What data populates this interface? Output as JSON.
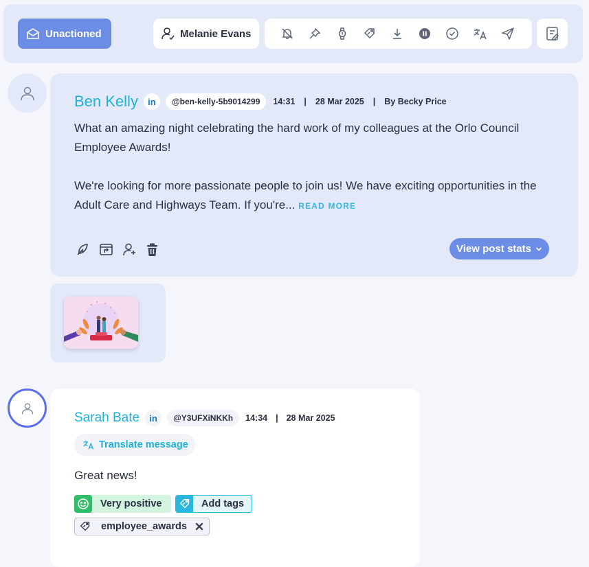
{
  "toolbar": {
    "status_label": "Unactioned",
    "assignee_name": "Melanie Evans",
    "tool_icons": [
      "bell-off-icon",
      "pin-icon",
      "watch-icon",
      "tag-icon",
      "download-icon",
      "pause-icon",
      "check-circle-icon",
      "translate-icon",
      "send-icon"
    ],
    "notes_icon": "notes-icon"
  },
  "post": {
    "author": "Ben Kelly",
    "network_badge": "in",
    "handle": "@ben-kelly-5b9014299",
    "time": "14:31",
    "separator": "|",
    "date": "28 Mar 2025",
    "by": "By Becky Price",
    "body_line1": "What an amazing night celebrating the hard work of my colleagues at the Orlo Council",
    "body_line2": "Employee Awards!",
    "body_line3": "We're looking for more passionate people to join us! We have exciting opportunities in the",
    "body_line4": "Adult Care and Highways Team. If you're...",
    "read_more": "READ MORE",
    "action_icons": [
      "feather-icon",
      "share-window-icon",
      "add-user-icon",
      "trash-icon"
    ],
    "stats_button": "View post stats"
  },
  "reply": {
    "author": "Sarah Bate",
    "network_badge": "in",
    "handle": "@Y3UFXiNKKh",
    "time": "14:34",
    "separator": "|",
    "date": "28 Mar 2025",
    "translate_label": "Translate message",
    "message": "Great news!",
    "sentiment_label": "Very positive",
    "add_tags_label": "Add tags",
    "tag_label": "employee_awards"
  },
  "colors": {
    "accent": "#6c8de6",
    "name": "#1fb1d8",
    "positive": "#2ebd68",
    "tag": "#29b7de"
  }
}
